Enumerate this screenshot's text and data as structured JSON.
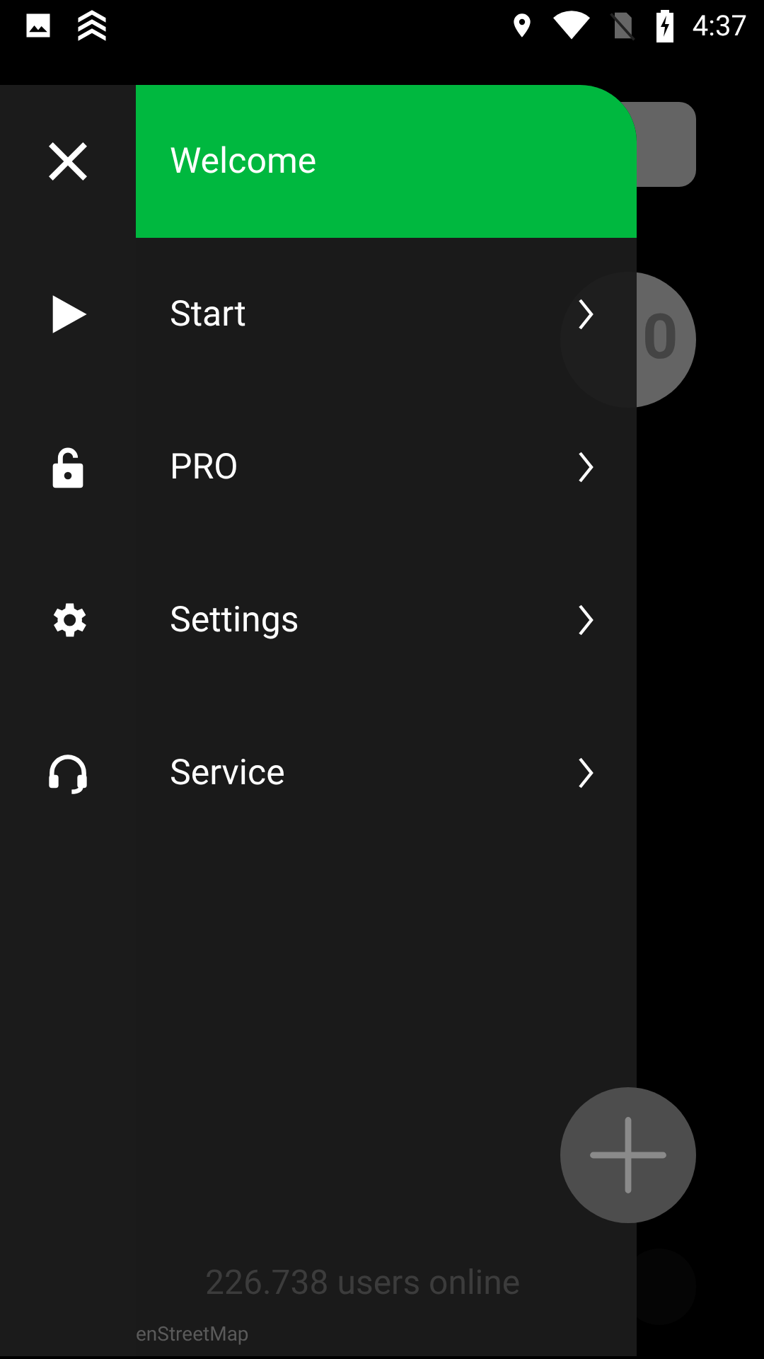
{
  "status_bar": {
    "time": "4:37"
  },
  "background": {
    "counter": "0",
    "users_online": "226.738 users online",
    "map_credit": "enStreetMap"
  },
  "drawer": {
    "header": "Welcome",
    "items": [
      {
        "label": "Start",
        "kind": "play"
      },
      {
        "label": "PRO",
        "kind": "lock"
      },
      {
        "label": "Settings",
        "kind": "gear"
      },
      {
        "label": "Service",
        "kind": "headset"
      }
    ]
  }
}
